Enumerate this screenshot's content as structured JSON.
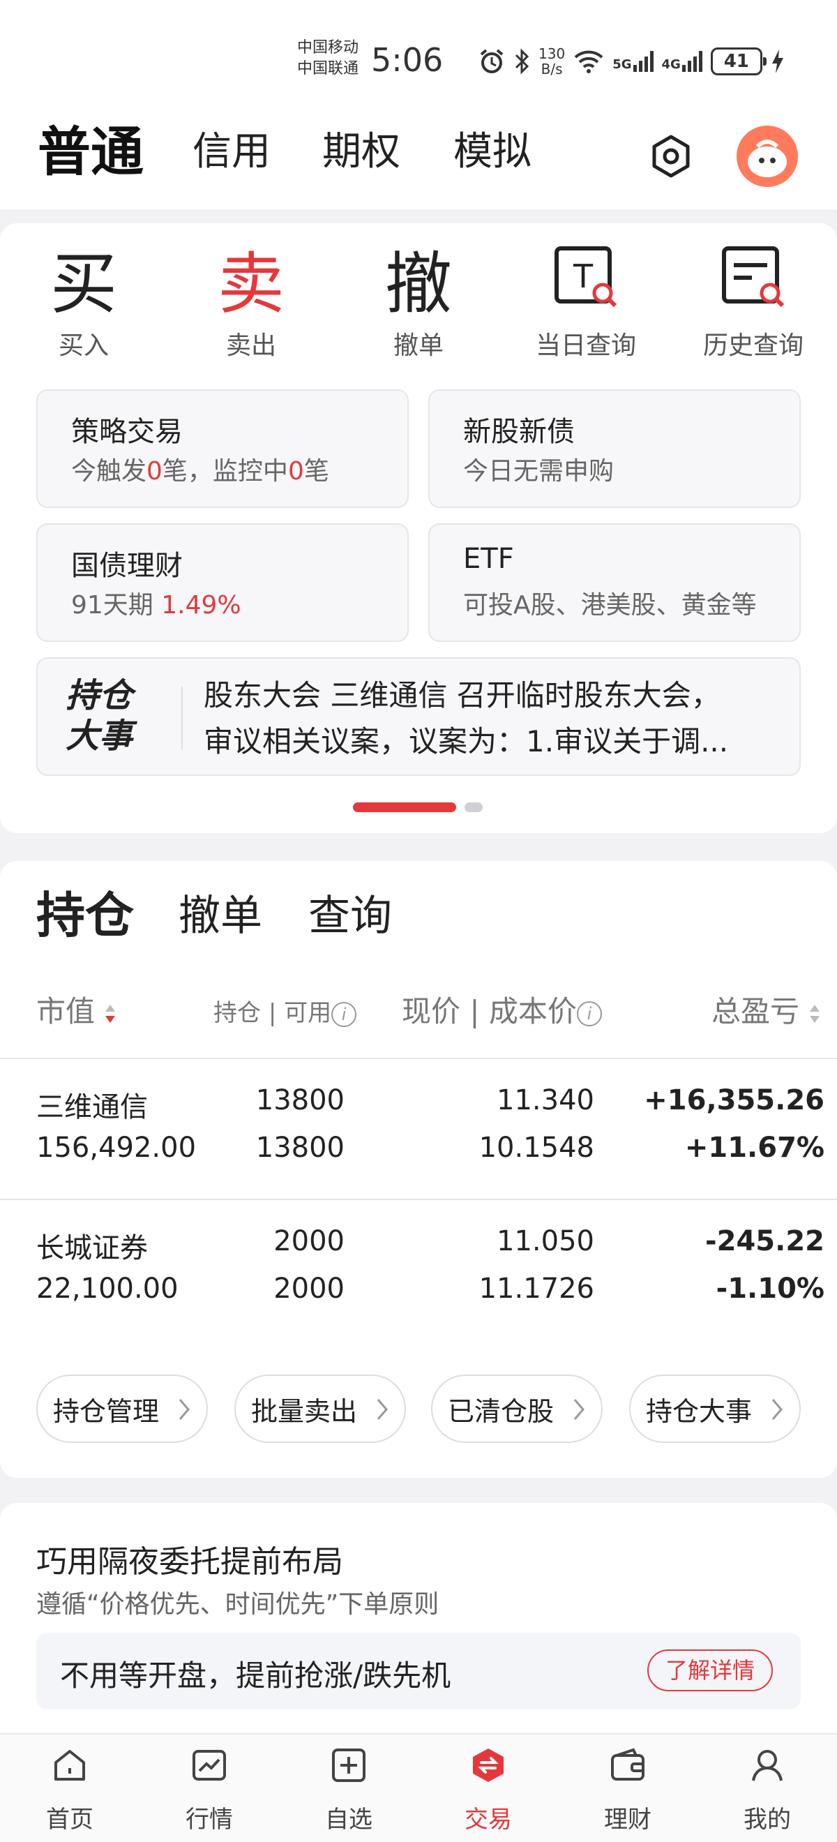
{
  "status_bar": {
    "carrier1": "中国移动",
    "carrier2": "中国联通",
    "time": "5:06",
    "net_speed_value": "130",
    "net_speed_unit": "B/s",
    "sig1": "5G",
    "sig2": "4G",
    "battery": "41"
  },
  "header": {
    "tabs": [
      "普通",
      "信用",
      "期权",
      "模拟"
    ],
    "active_tab": "普通"
  },
  "quick_actions": [
    {
      "glyph": "买",
      "label": "买入"
    },
    {
      "glyph": "卖",
      "label": "卖出"
    },
    {
      "glyph": "撤",
      "label": "撤单"
    },
    {
      "glyph": "T",
      "label": "当日查询"
    },
    {
      "glyph": "",
      "label": "历史查询"
    }
  ],
  "services": {
    "strategy": {
      "title": "策略交易",
      "sub_pre": "今触发",
      "sub_n1": "0",
      "sub_mid": "笔，监控中",
      "sub_n2": "0",
      "sub_post": "笔"
    },
    "ipo": {
      "title": "新股新债",
      "sub": "今日无需申购"
    },
    "bond": {
      "title": "国债理财",
      "sub_pre": "91天期 ",
      "sub_rate": "1.49%"
    },
    "etf": {
      "title": "ETF",
      "sub": "可投A股、港美股、黄金等"
    }
  },
  "news": {
    "tag_line1": "持仓",
    "tag_line2": "大事",
    "line1": "股东大会 三维通信 召开临时股东大会，",
    "line2": "审议相关议案，议案为：1.审议关于调..."
  },
  "positions": {
    "tabs": [
      "持仓",
      "撤单",
      "查询"
    ],
    "headers": {
      "market_value": "市值",
      "holding": "持仓",
      "sep1": "|",
      "available": "可用",
      "price": "现价",
      "sep2": "|",
      "cost": "成本价",
      "pnl": "总盈亏",
      "info": "i"
    },
    "rows": [
      {
        "name": "三维通信",
        "market_value": "156,492.00",
        "holding": "13800",
        "available": "13800",
        "price": "11.340",
        "cost": "10.1548",
        "pnl": "+16,355.26",
        "pnl_pct": "+11.67%",
        "trend": "up"
      },
      {
        "name": "长城证券",
        "market_value": "22,100.00",
        "holding": "2000",
        "available": "2000",
        "price": "11.050",
        "cost": "11.1726",
        "pnl": "-245.22",
        "pnl_pct": "-1.10%",
        "trend": "down"
      }
    ],
    "actions": [
      "持仓管理",
      "批量卖出",
      "已清仓股",
      "持仓大事"
    ]
  },
  "promo": {
    "title": "巧用隔夜委托提前布局",
    "subtitle": "遵循“价格优先、时间优先”下单原则",
    "box_text": "不用等开盘，提前抢涨/跌先机",
    "button": "了解详情"
  },
  "bottom_nav": [
    {
      "label": "首页",
      "icon": "home-icon"
    },
    {
      "label": "行情",
      "icon": "chart-icon"
    },
    {
      "label": "自选",
      "icon": "add-square-icon"
    },
    {
      "label": "交易",
      "icon": "trade-icon",
      "active": true
    },
    {
      "label": "理财",
      "icon": "wallet-icon"
    },
    {
      "label": "我的",
      "icon": "user-icon"
    }
  ],
  "colors": {
    "accent_red": "#e5383b",
    "up": "#e5383b",
    "down": "#139e6b"
  }
}
